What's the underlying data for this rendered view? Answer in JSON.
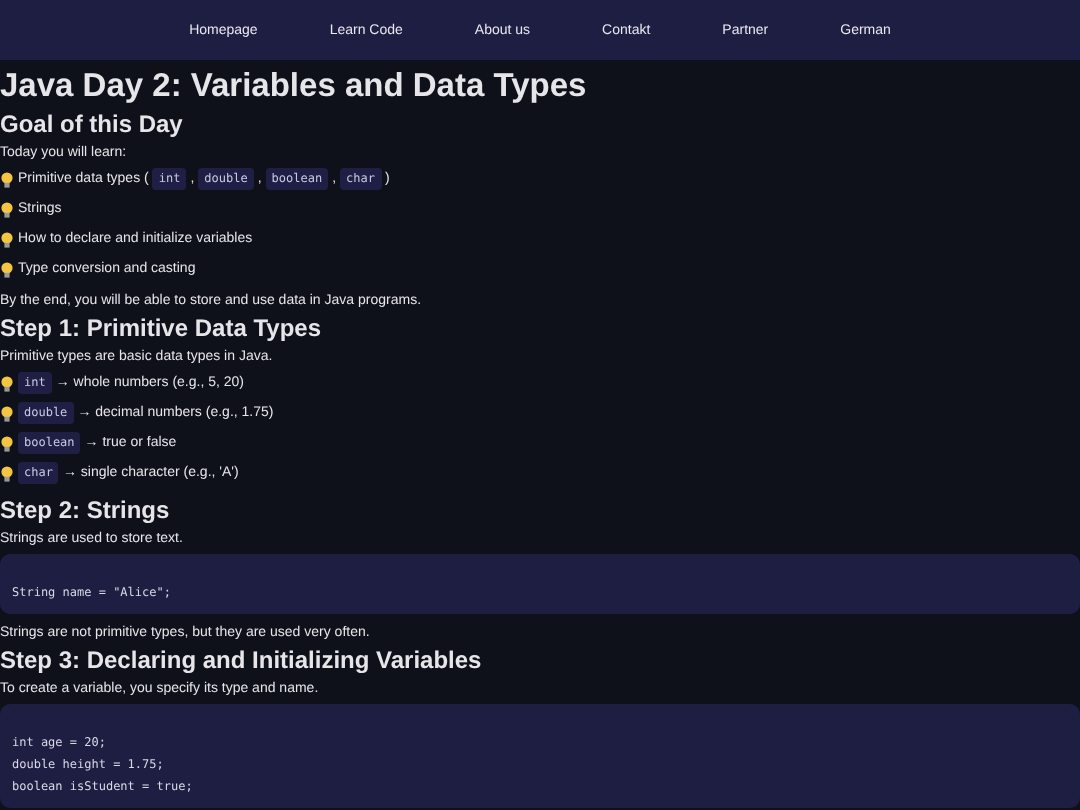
{
  "nav": [
    {
      "label": "Homepage"
    },
    {
      "label": "Learn Code"
    },
    {
      "label": "About us"
    },
    {
      "label": "Contakt"
    },
    {
      "label": "Partner"
    },
    {
      "label": "German"
    }
  ],
  "title": "Java Day 2: Variables and Data Types",
  "sections": [
    {
      "heading": "Goal of this Day",
      "blocks": [
        {
          "kind": "paragraph",
          "text": "Today you will learn:"
        },
        {
          "kind": "list",
          "items": [
            {
              "parts": [
                {
                  "kind": "text",
                  "text": "Primitive data types ("
                },
                {
                  "kind": "code",
                  "text": "int"
                },
                {
                  "kind": "text",
                  "text": ","
                },
                {
                  "kind": "code",
                  "text": "double"
                },
                {
                  "kind": "text",
                  "text": ","
                },
                {
                  "kind": "code",
                  "text": "boolean"
                },
                {
                  "kind": "text",
                  "text": ","
                },
                {
                  "kind": "code",
                  "text": "char"
                },
                {
                  "kind": "text",
                  "text": ")"
                }
              ]
            },
            {
              "parts": [
                {
                  "kind": "text",
                  "text": "Strings"
                }
              ]
            },
            {
              "parts": [
                {
                  "kind": "text",
                  "text": "How to declare and initialize variables"
                }
              ]
            },
            {
              "parts": [
                {
                  "kind": "text",
                  "text": "Type conversion and casting"
                }
              ]
            }
          ]
        },
        {
          "kind": "paragraph",
          "text": "By the end, you will be able to store and use data in Java programs."
        }
      ]
    },
    {
      "heading": "Step 1: Primitive Data Types",
      "blocks": [
        {
          "kind": "paragraph",
          "text": "Primitive types are basic data types in Java."
        },
        {
          "kind": "list",
          "items": [
            {
              "parts": [
                {
                  "kind": "code",
                  "text": "int"
                },
                {
                  "kind": "text",
                  "text": "→ whole numbers (e.g., 5, 20)"
                }
              ]
            },
            {
              "parts": [
                {
                  "kind": "code",
                  "text": "double"
                },
                {
                  "kind": "text",
                  "text": "→ decimal numbers (e.g., 1.75)"
                }
              ]
            },
            {
              "parts": [
                {
                  "kind": "code",
                  "text": "boolean"
                },
                {
                  "kind": "text",
                  "text": "→ true or false"
                }
              ]
            },
            {
              "parts": [
                {
                  "kind": "code",
                  "text": "char"
                },
                {
                  "kind": "text",
                  "text": "→ single character (e.g., 'A')"
                }
              ]
            }
          ]
        }
      ]
    },
    {
      "heading": "Step 2: Strings",
      "blocks": [
        {
          "kind": "paragraph",
          "text": "Strings are used to store text."
        },
        {
          "kind": "codeblock",
          "lines": [
            "String name = \"Alice\";"
          ]
        },
        {
          "kind": "paragraph",
          "text": "Strings are not primitive types, but they are used very often."
        }
      ]
    },
    {
      "heading": "Step 3: Declaring and Initializing Variables",
      "blocks": [
        {
          "kind": "paragraph",
          "text": "To create a variable, you specify its type and name."
        },
        {
          "kind": "codeblock",
          "lines": [
            "int age = 20;",
            "double height = 1.75;",
            "boolean isStudent = true;"
          ]
        }
      ]
    }
  ]
}
